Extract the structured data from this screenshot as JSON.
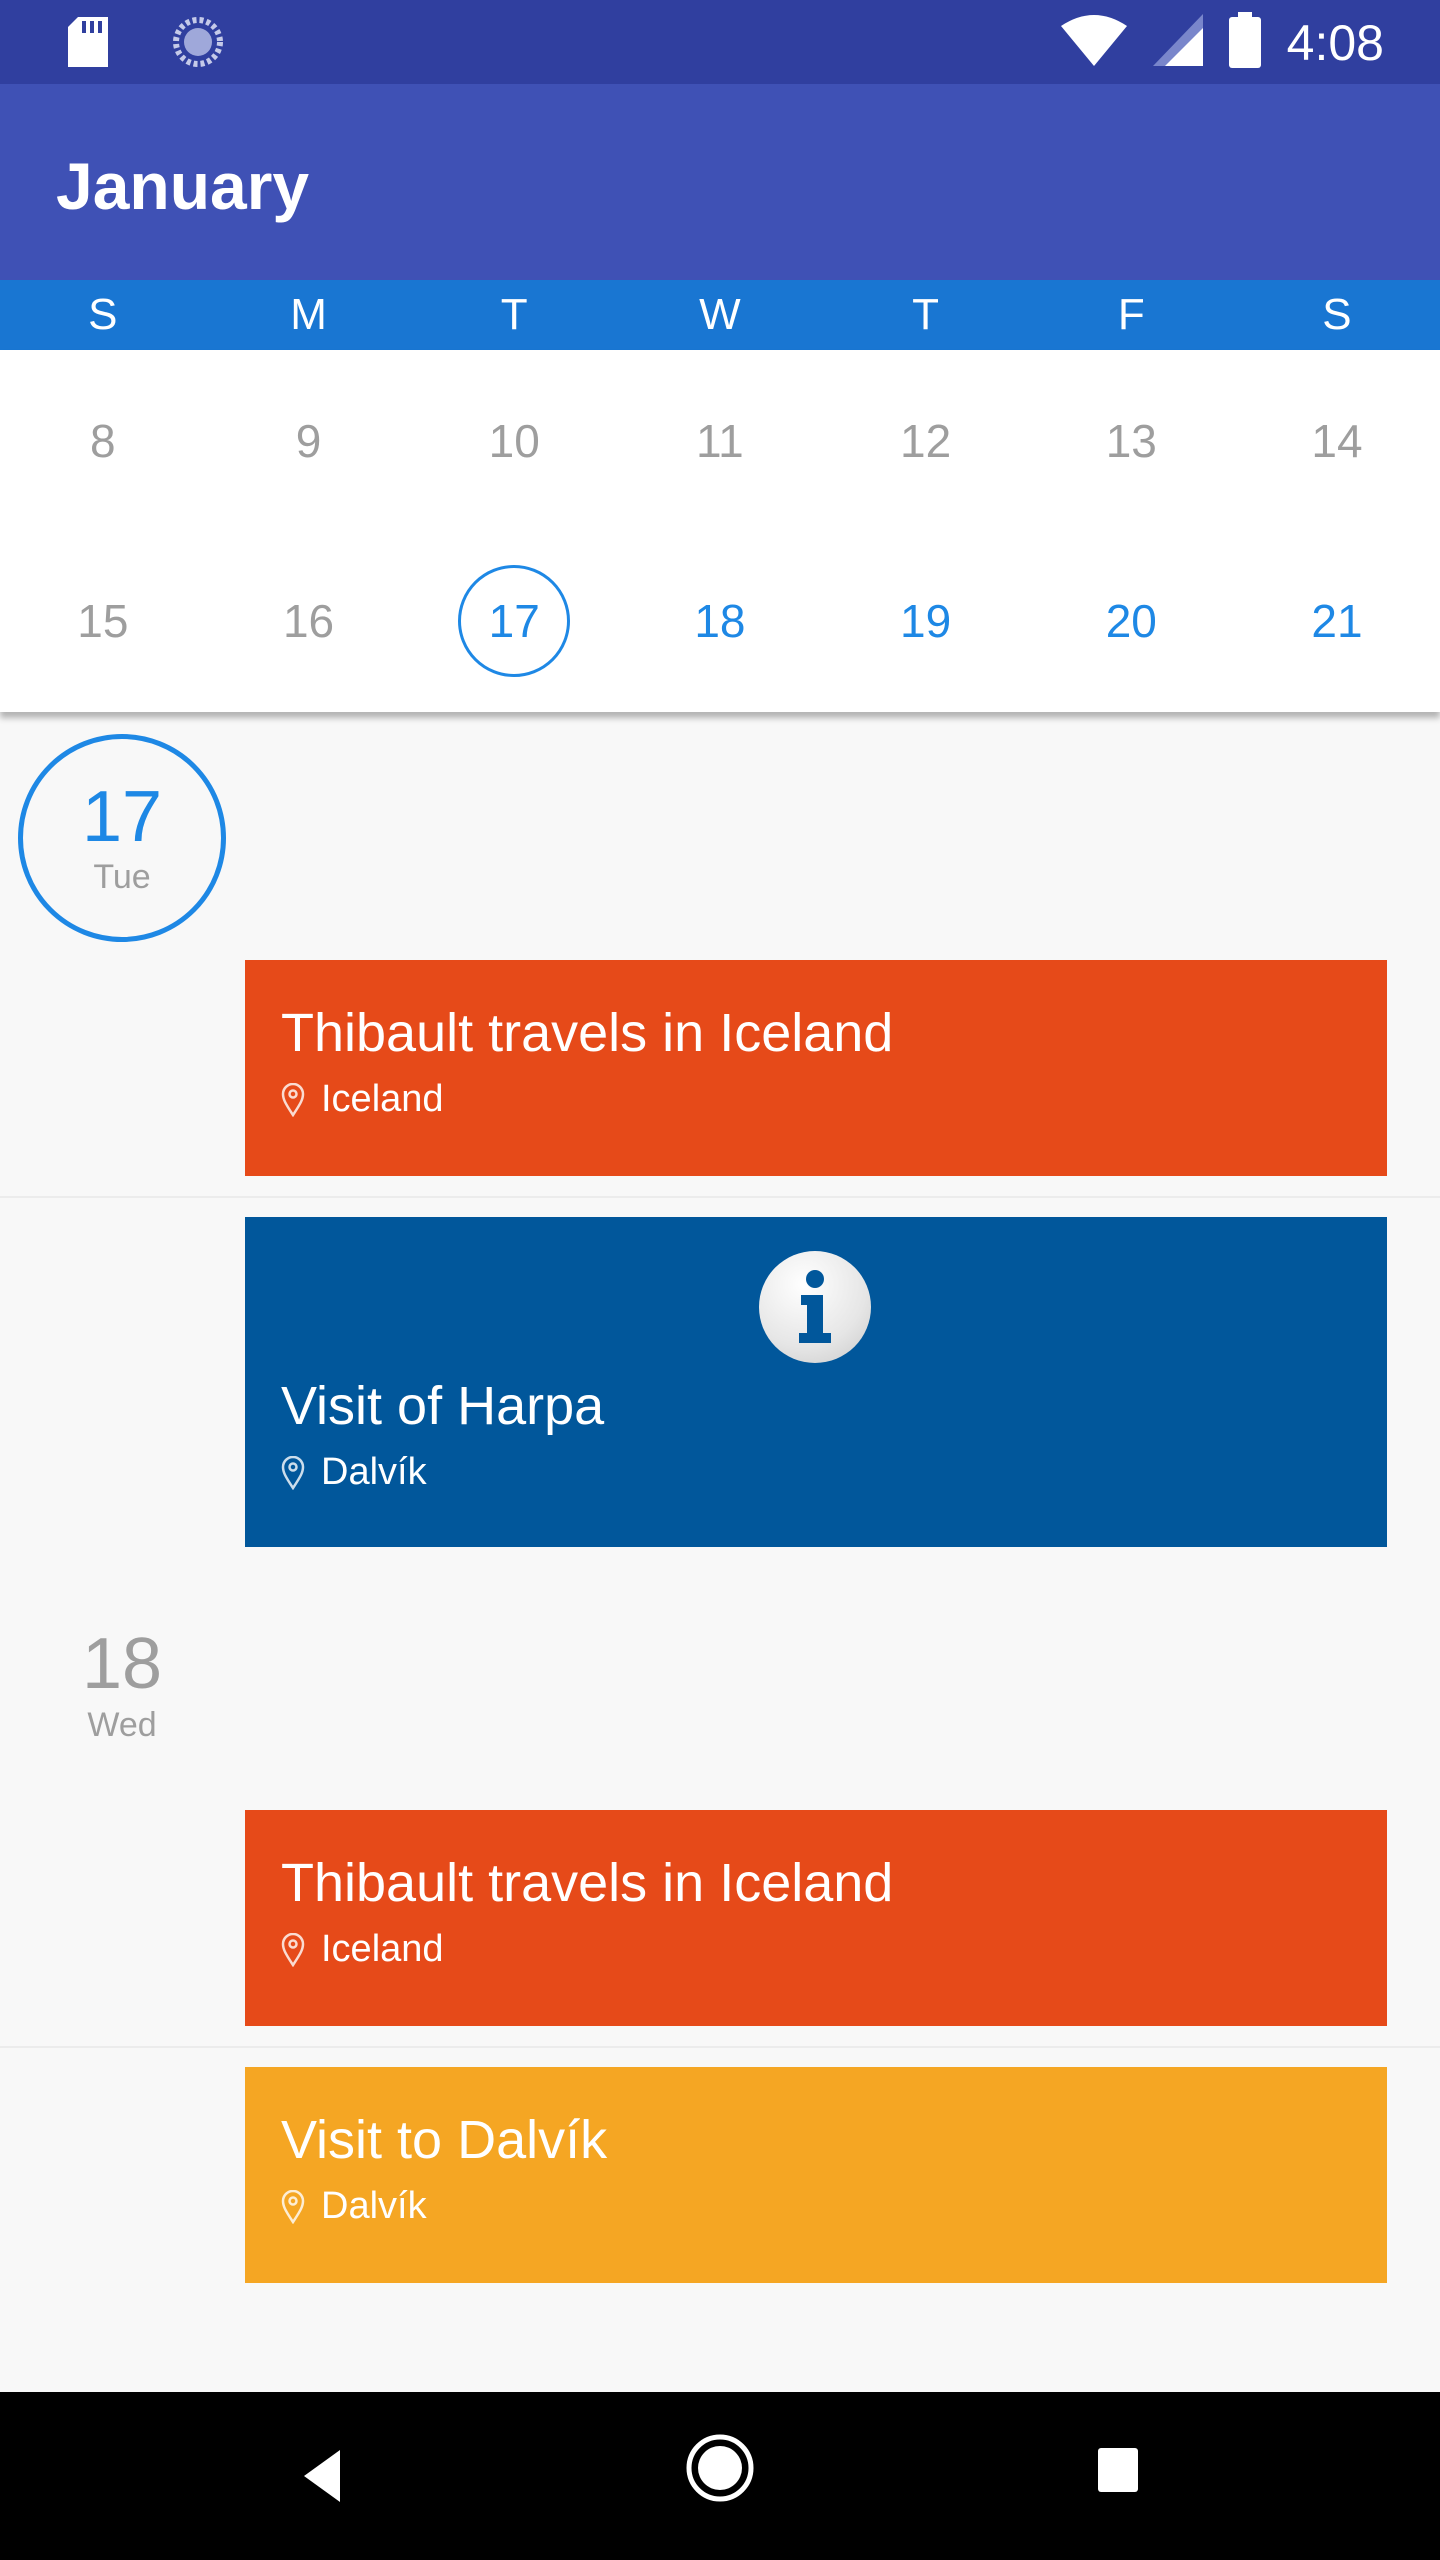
{
  "status_bar": {
    "time": "4:08",
    "icons": [
      "sd-card-icon",
      "sync-icon",
      "wifi-icon",
      "signal-icon",
      "battery-icon"
    ]
  },
  "app_bar": {
    "title": "January"
  },
  "weekdays": [
    "S",
    "M",
    "T",
    "W",
    "T",
    "F",
    "S"
  ],
  "calendar": {
    "row1": [
      "8",
      "9",
      "10",
      "11",
      "12",
      "13",
      "14"
    ],
    "row2": [
      "15",
      "16",
      "17",
      "18",
      "19",
      "20",
      "21"
    ],
    "selected_day": "17"
  },
  "agenda": {
    "days": [
      {
        "number": "17",
        "weekday": "Tue",
        "events": [
          {
            "title": "Thibault travels in Iceland",
            "location": "Iceland",
            "color": "#e64a19"
          },
          {
            "title": "Visit of Harpa",
            "location": "Dalvík",
            "color": "#01579b"
          }
        ]
      },
      {
        "number": "18",
        "weekday": "Wed",
        "events": [
          {
            "title": "Thibault travels in Iceland",
            "location": "Iceland",
            "color": "#e64a19"
          },
          {
            "title": "Visit to Dalvík",
            "location": "Dalvík",
            "color": "#f5a623"
          }
        ]
      }
    ]
  },
  "colors": {
    "status_bar": "#303f9f",
    "app_bar": "#3f51b5",
    "weekday_header": "#1976d2",
    "accent": "#1e88e5"
  },
  "nav_bar": {
    "buttons": [
      "back-icon",
      "home-icon",
      "recents-icon"
    ]
  }
}
